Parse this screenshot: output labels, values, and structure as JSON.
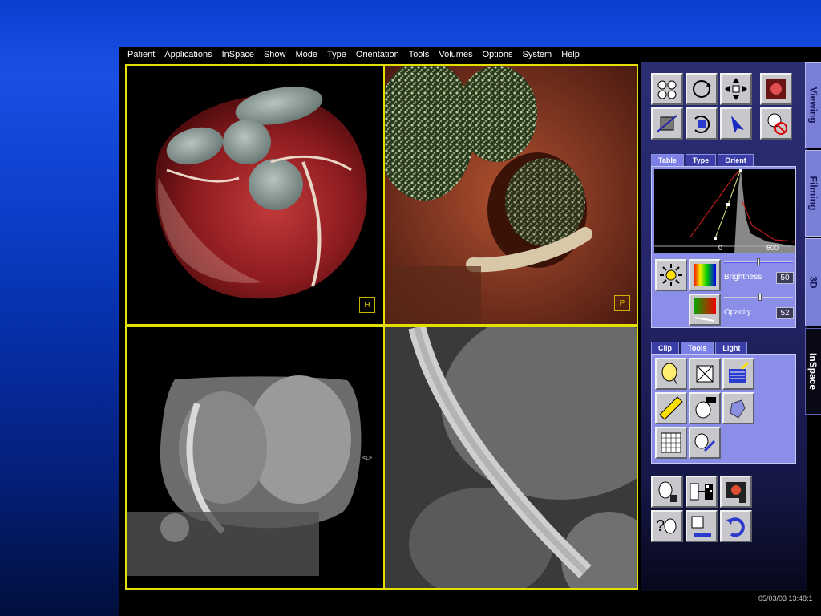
{
  "menu": [
    "Patient",
    "Applications",
    "InSpace",
    "Show",
    "Mode",
    "Type",
    "Orientation",
    "Tools",
    "Volumes",
    "Options",
    "System",
    "Help"
  ],
  "side_tabs": {
    "viewing": "Viewing",
    "filming": "Filming",
    "threed": "3D",
    "inspace": "InSpace"
  },
  "viewports": {
    "vp1": {
      "orientation": "H"
    },
    "vp2": {
      "orientation": "P"
    },
    "vp3": {
      "marker": "<L>"
    }
  },
  "lut_tabs": {
    "table": "Table",
    "type": "Type",
    "orient": "Orient"
  },
  "histogram": {
    "tick0": "0",
    "tick1": "600"
  },
  "brightness": {
    "label": "Brightness",
    "value": "50",
    "level": 0.5
  },
  "opacity": {
    "label": "Opacity",
    "value": "52",
    "level": 0.52
  },
  "tool_tabs": {
    "clip": "Clip",
    "tools": "Tools",
    "light": "Light"
  },
  "datetime": "05/03/03 13:48:1",
  "icons": [
    "pan-zoom-rotate-icon",
    "rotate-icon",
    "move-icon",
    "viewing-mode-icon",
    "volume-rotate-icon",
    "hand-rotate-icon",
    "pointer-icon",
    "temperature-no-icon",
    "sun-icon",
    "color-palette-icon",
    "opacity-ramp-icon",
    "head-clip-icon",
    "box-clip-icon",
    "notepad-icon",
    "measure-icon",
    "head-zoom-icon",
    "shape-icon",
    "grid-icon",
    "angle-icon",
    "save-head-icon",
    "transfer-icon",
    "film-icon",
    "help-head-icon",
    "export-icon",
    "refresh-icon"
  ],
  "colors": {
    "accent": "#e3e000",
    "panel": "#242669",
    "button": "#c8c8cc",
    "tab": "#7a80d6"
  }
}
